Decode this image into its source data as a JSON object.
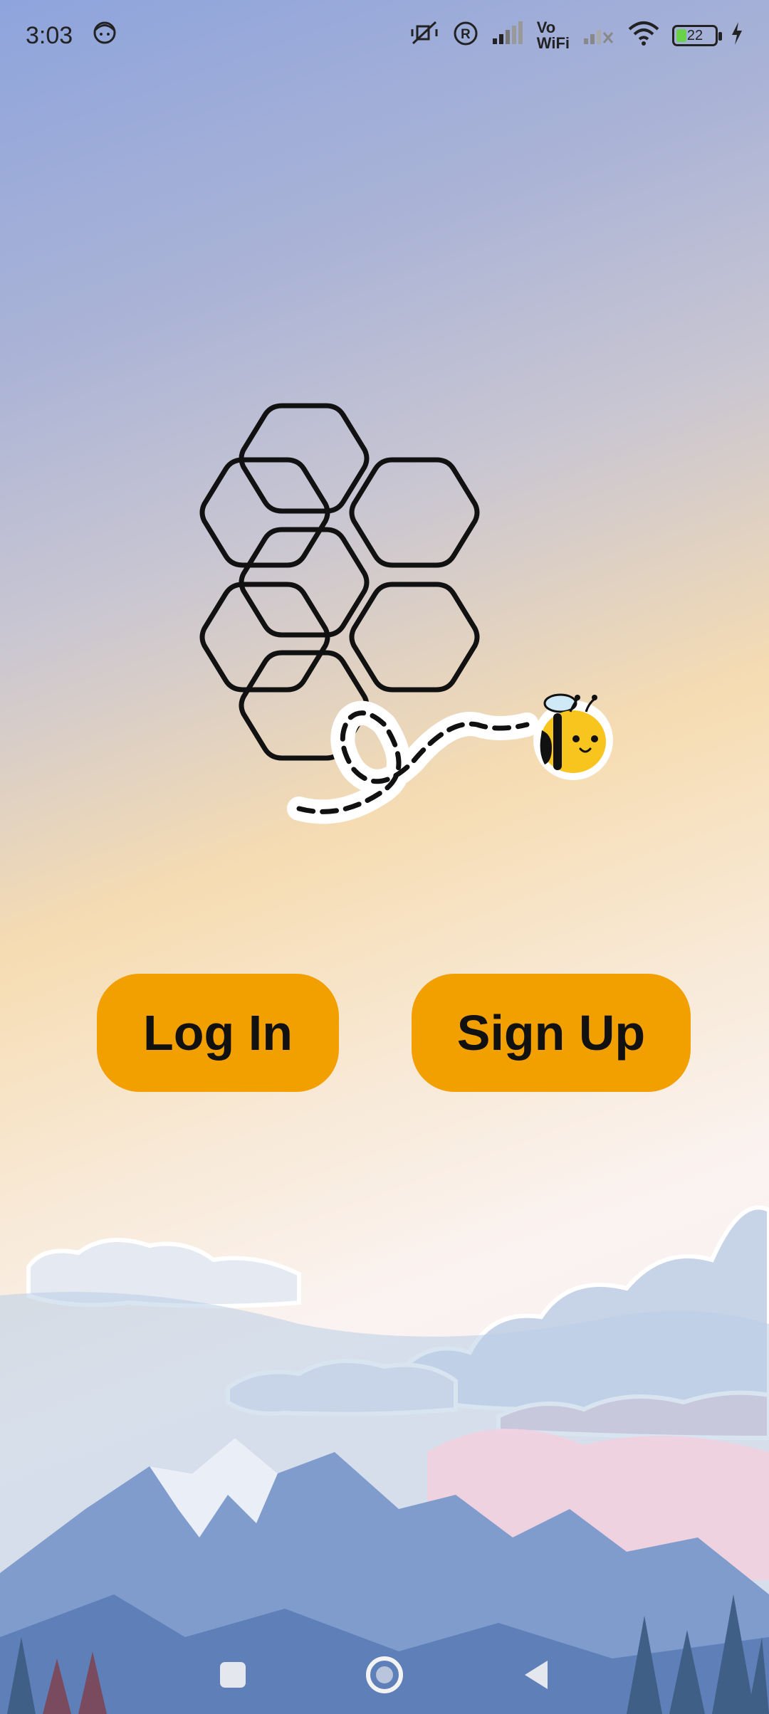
{
  "status_bar": {
    "time": "3:03",
    "vo_label_top": "Vo",
    "vo_label_bottom": "WiFi",
    "battery_level": "22"
  },
  "auth": {
    "login_label": "Log In",
    "signup_label": "Sign Up"
  },
  "colors": {
    "button_bg": "#f29f00",
    "button_text": "#111111"
  }
}
